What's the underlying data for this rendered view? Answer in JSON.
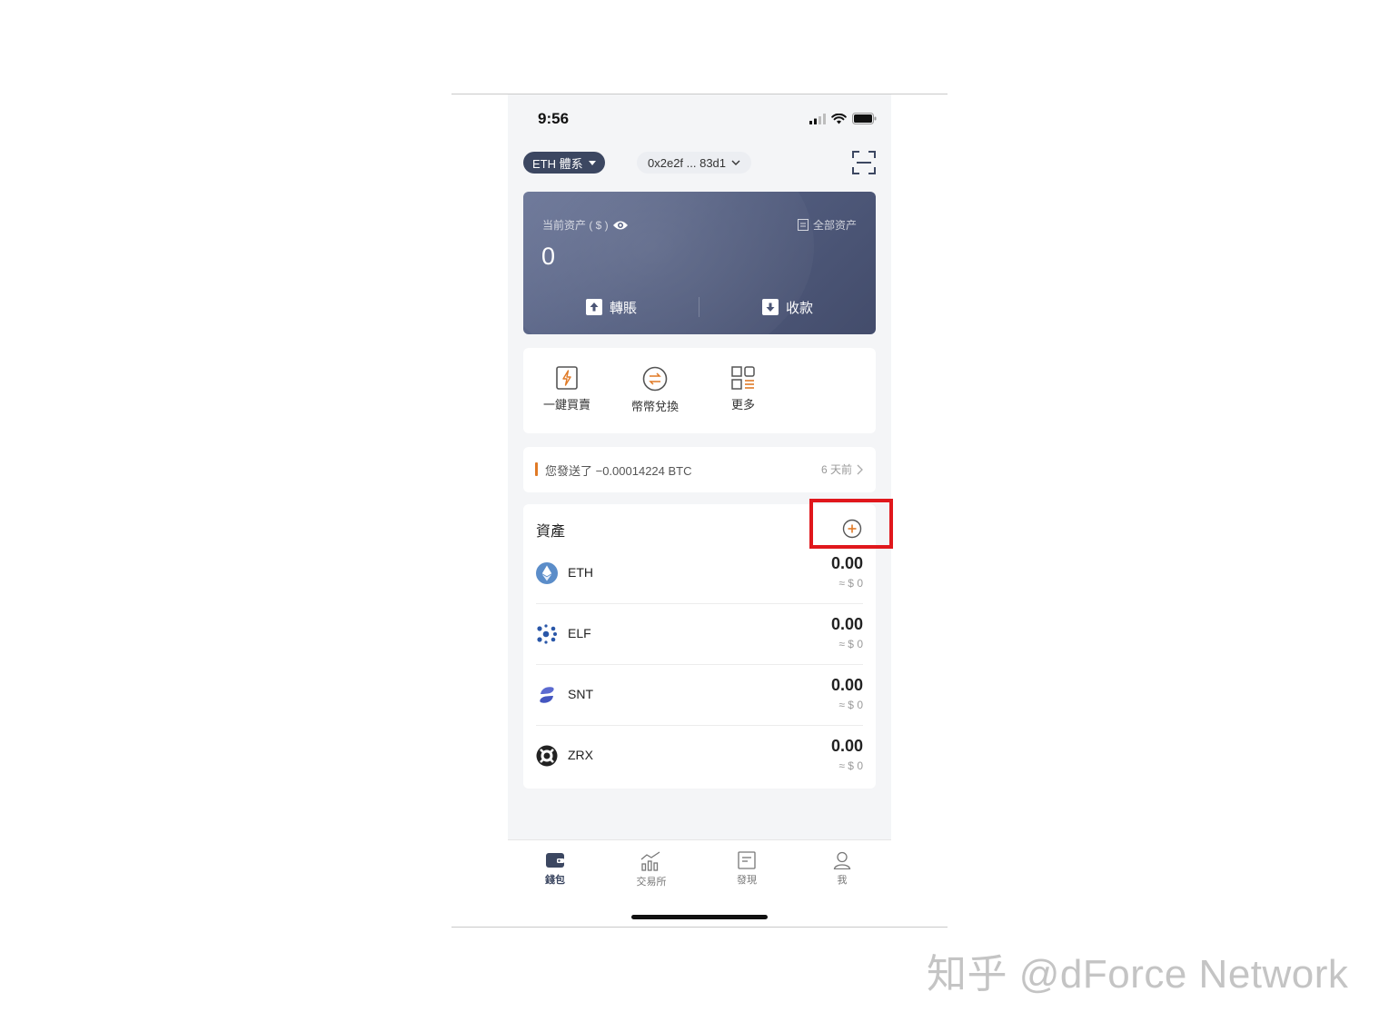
{
  "status_bar": {
    "time": "9:56",
    "icons": [
      "signal-icon",
      "wifi-icon",
      "battery-icon"
    ]
  },
  "header": {
    "chain_label": "ETH 體系",
    "address": "0x2e2f ... 83d1",
    "scan_icon": "scan-icon"
  },
  "balance_card": {
    "label": "当前资产 ( $ )",
    "all_assets_label": "全部资产",
    "value": "0",
    "transfer_label": "轉賬",
    "receive_label": "收款"
  },
  "quick_actions": [
    {
      "label": "一鍵買賣",
      "icon": "lightning-card-icon"
    },
    {
      "label": "幣幣兌換",
      "icon": "swap-icon"
    },
    {
      "label": "更多",
      "icon": "grid-icon"
    }
  ],
  "recent_tx": {
    "text": "您發送了 −0.00014224 BTC",
    "time": "6 天前"
  },
  "assets": {
    "title": "資產",
    "items": [
      {
        "symbol": "ETH",
        "amount": "0.00",
        "usd": "≈ $ 0"
      },
      {
        "symbol": "ELF",
        "amount": "0.00",
        "usd": "≈ $ 0"
      },
      {
        "symbol": "SNT",
        "amount": "0.00",
        "usd": "≈ $ 0"
      },
      {
        "symbol": "ZRX",
        "amount": "0.00",
        "usd": "≈ $ 0"
      }
    ]
  },
  "tabbar": [
    {
      "label": "錢包",
      "active": true
    },
    {
      "label": "交易所",
      "active": false
    },
    {
      "label": "發現",
      "active": false
    },
    {
      "label": "我",
      "active": false
    }
  ],
  "colors": {
    "accent": "#e07a26",
    "card": "#4b5576",
    "highlight": "#e0171c"
  },
  "watermark": "知乎 @dForce Network"
}
